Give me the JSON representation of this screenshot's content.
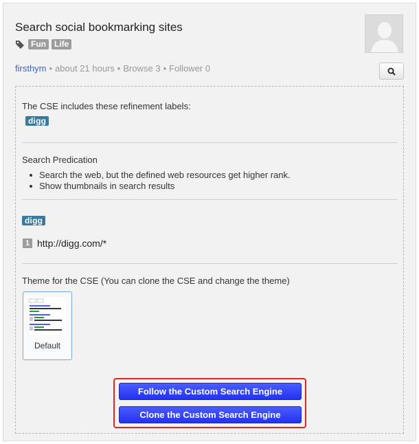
{
  "header": {
    "title": "Search social bookmarking sites",
    "tags": [
      "Fun",
      "Life"
    ],
    "meta": {
      "user": "firsthym",
      "time": "about 21 hours",
      "browse": "Browse 3",
      "follower": "Follower 0"
    }
  },
  "refinements": {
    "label": "The CSE includes these refinement labels:",
    "badge": "digg"
  },
  "predication": {
    "label": "Search Predication",
    "items": [
      "Search the web, but the defined web resources get higher rank.",
      "Show thumbnails in search results"
    ]
  },
  "resources": {
    "badge": "digg",
    "urls": [
      {
        "num": "1",
        "url": "http://digg.com/*"
      }
    ]
  },
  "theme": {
    "label": "Theme for the CSE  (You can clone the CSE and change the theme)",
    "selected": "Default"
  },
  "actions": {
    "follow": "Follow the Custom Search Engine",
    "clone": "Clone the Custom Search Engine"
  },
  "colors": {
    "accent_blue": "#3344ff",
    "highlight_red": "#e8231d",
    "tag_gray": "#9c9c9c",
    "digg_blue": "#3b7a9f",
    "link_blue": "#3a65c9"
  },
  "icons": [
    "tag-icon",
    "avatar-silhouette",
    "search-icon"
  ]
}
